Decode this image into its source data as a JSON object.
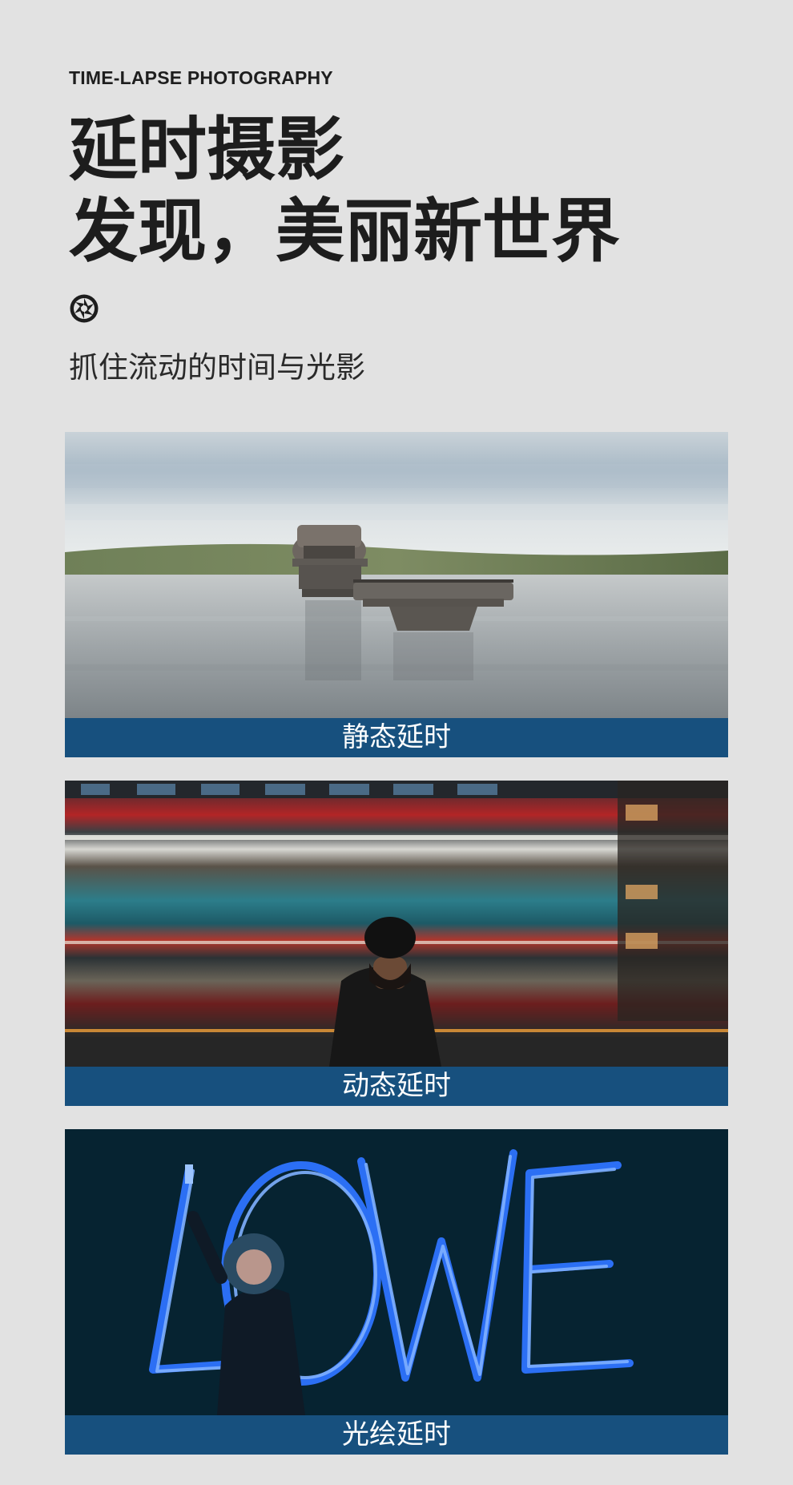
{
  "header": {
    "eyebrow": "TIME-LAPSE PHOTOGRAPHY",
    "title_line1": "延时摄影",
    "title_line2": "发现，美丽新世界",
    "tagline": "抓住流动的时间与光影"
  },
  "cards": [
    {
      "caption": "静态延时",
      "photo": "lake-tower-long-exposure"
    },
    {
      "caption": "动态延时",
      "photo": "man-with-bus-motion-blur"
    },
    {
      "caption": "光绘延时",
      "photo": "light-painting-love"
    }
  ],
  "colors": {
    "background": "#e2e2e2",
    "caption_bar": "#17507e",
    "title_text": "#1d1d1d"
  },
  "icons": [
    "aperture-icon"
  ]
}
